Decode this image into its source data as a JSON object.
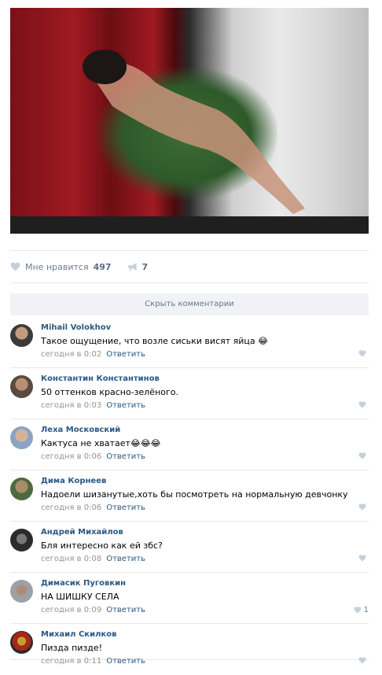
{
  "post": {
    "likes_label": "Мне нравится",
    "likes_count": "497",
    "shares_count": "7",
    "hide_comments": "Скрыть комментарии"
  },
  "comments": [
    {
      "author": "Mihail Volokhov",
      "text": "Такое ощущение, что возле сиськи висят яйца 😂",
      "time": "сегодня в 0:02",
      "reply": "Ответить",
      "likes": ""
    },
    {
      "author": "Константин Константинов",
      "text": "50 оттенков красно-зелёного.",
      "time": "сегодня в 0:03",
      "reply": "Ответить",
      "likes": ""
    },
    {
      "author": "Леха Московский",
      "text": "Кактуса не хватает😂😂😂",
      "time": "сегодня в 0:06",
      "reply": "Ответить",
      "likes": ""
    },
    {
      "author": "Дима Корнеев",
      "text": "Надоели шизанутые,хоть бы посмотреть на нормальную девчонку",
      "time": "сегодня в 0:06",
      "reply": "Ответить",
      "likes": ""
    },
    {
      "author": "Андрей Михайлов",
      "text": "Бля интересно как ей збс?",
      "time": "сегодня в 0:08",
      "reply": "Ответить",
      "likes": ""
    },
    {
      "author": "Димасик Пуговкин",
      "text": "НА ШИШКУ СЕЛА",
      "time": "сегодня в 0:09",
      "reply": "Ответить",
      "likes": "1"
    },
    {
      "author": "Михаил Скилков",
      "text": "Пизда пизде!",
      "time": "сегодня в 0:11",
      "reply": "Ответить",
      "likes": ""
    }
  ],
  "colors": {
    "link": "#2a5885",
    "meta": "#939393",
    "divider": "#e7e8ec"
  }
}
